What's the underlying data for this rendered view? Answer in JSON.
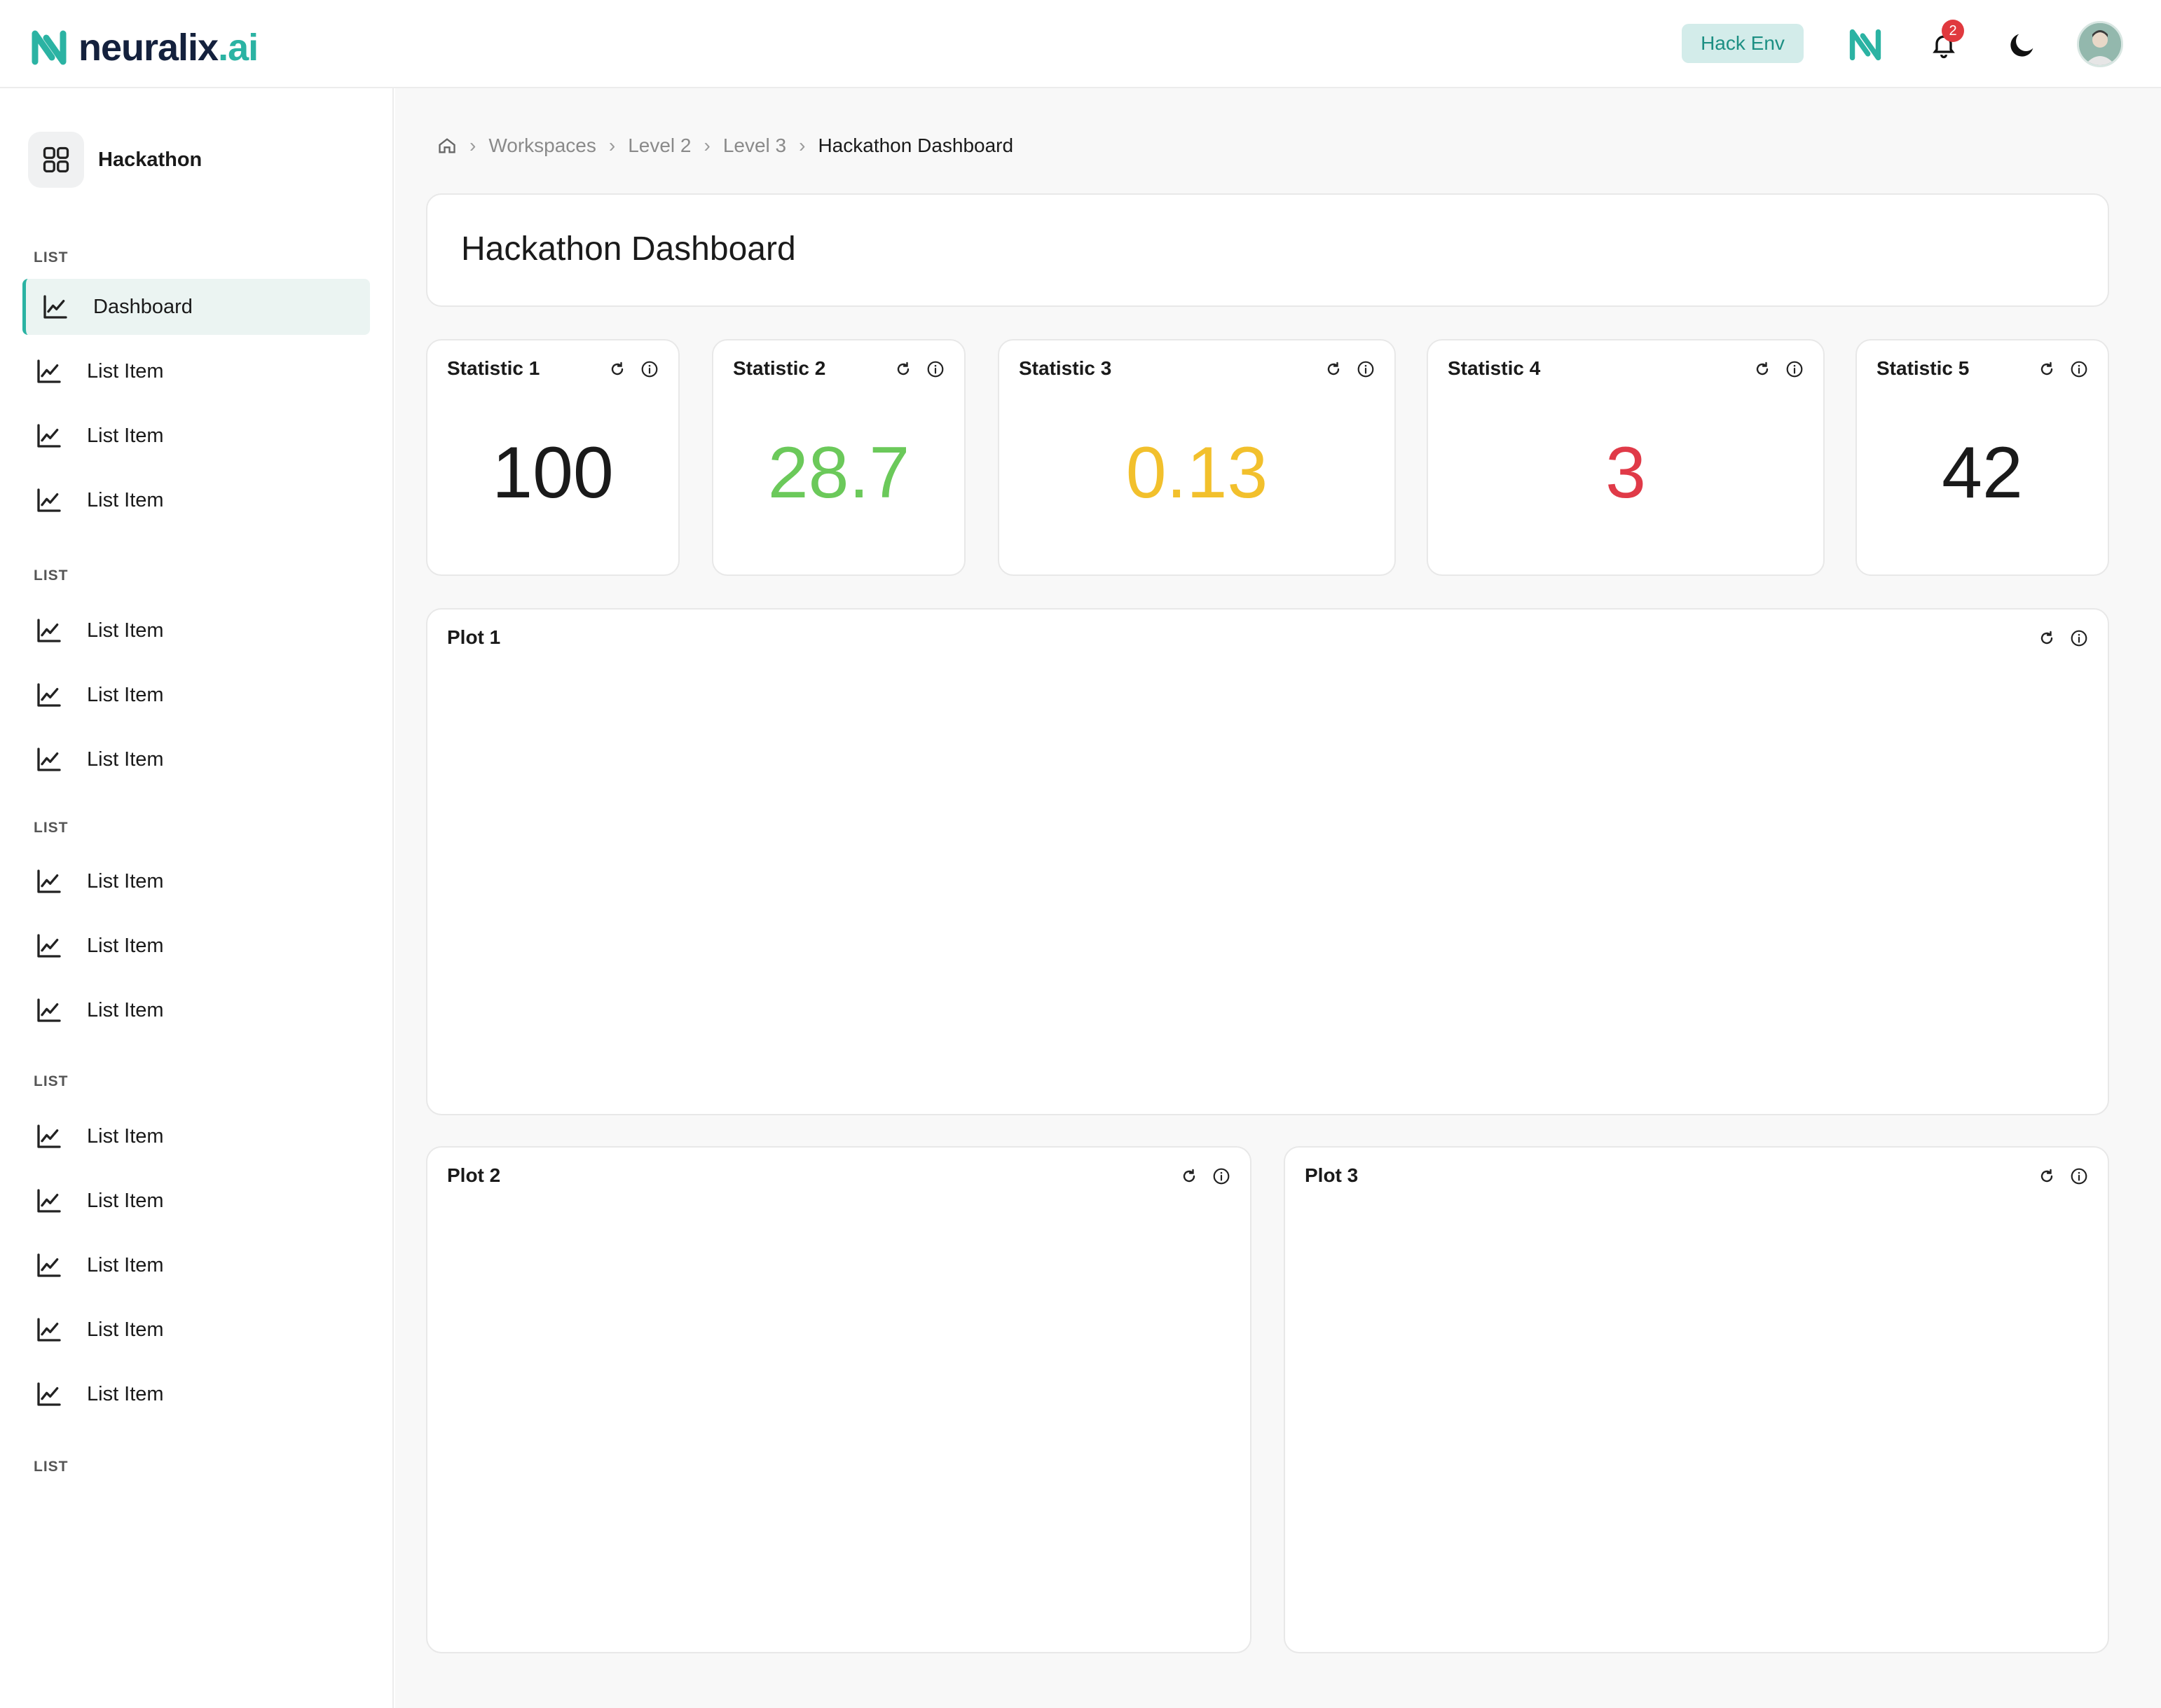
{
  "app": {
    "logo_name": "neuralix",
    "logo_tld": ".ai",
    "env_label": "Hack Env",
    "notification_count": "2"
  },
  "sidebar": {
    "workspace_name": "Hackathon",
    "sections": [
      {
        "label": "LIST",
        "items": [
          "Dashboard",
          "List Item",
          "List Item",
          "List Item"
        ]
      },
      {
        "label": "LIST",
        "items": [
          "List Item",
          "List Item",
          "List Item"
        ]
      },
      {
        "label": "LIST",
        "items": [
          "List Item",
          "List Item",
          "List Item"
        ]
      },
      {
        "label": "LIST",
        "items": [
          "List Item",
          "List Item",
          "List Item",
          "List Item",
          "List Item"
        ]
      },
      {
        "label": "LIST",
        "items": []
      }
    ],
    "active_item": "Dashboard"
  },
  "breadcrumb": [
    "Workspaces",
    "Level 2",
    "Level 3",
    "Hackathon Dashboard"
  ],
  "page_title": "Hackathon Dashboard",
  "stats": [
    {
      "label": "Statistic 1",
      "value": "100",
      "color": "#1a1a1a"
    },
    {
      "label": "Statistic 2",
      "value": "28.7",
      "color": "#6bc95a"
    },
    {
      "label": "Statistic 3",
      "value": "0.13",
      "color": "#f2c02c"
    },
    {
      "label": "Statistic 4",
      "value": "3",
      "color": "#e03a48"
    },
    {
      "label": "Statistic 5",
      "value": "42",
      "color": "#1a1a1a"
    }
  ],
  "plots": [
    {
      "label": "Plot 1"
    },
    {
      "label": "Plot 2"
    },
    {
      "label": "Plot 3"
    }
  ],
  "icons": {
    "refresh": "refresh-icon",
    "info": "info-icon",
    "bell": "bell-icon",
    "theme": "moon-icon"
  }
}
